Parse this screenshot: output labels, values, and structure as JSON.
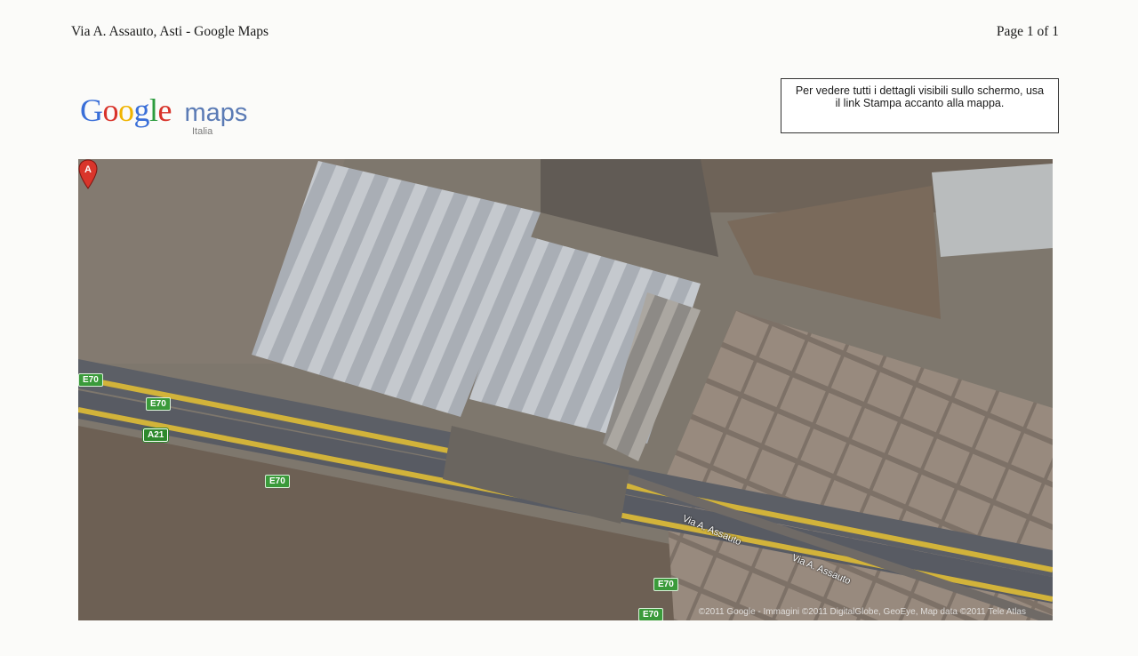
{
  "header": {
    "title": "Via A. Assauto, Asti - Google Maps",
    "page": "Page 1 of 1"
  },
  "logo": {
    "letters": [
      "G",
      "o",
      "o",
      "g",
      "l",
      "e"
    ],
    "letter_colors": [
      "#3a6fd8",
      "#d8332a",
      "#f0b400",
      "#3a6fd8",
      "#2c9c3e",
      "#d8332a"
    ],
    "product": "maps",
    "country": "Italia"
  },
  "notice": {
    "text": "Per vedere tutti i dettagli visibili sullo schermo, usa il link Stampa accanto alla mappa."
  },
  "map": {
    "type": "satellite",
    "marker": {
      "label": "A",
      "color": "#d9352b",
      "icon": "map-pin-icon"
    },
    "road_shields": [
      {
        "text": "E70"
      },
      {
        "text": "E70"
      },
      {
        "text": "A21"
      },
      {
        "text": "E70"
      },
      {
        "text": "E70"
      },
      {
        "text": "E70"
      }
    ],
    "street_labels": [
      {
        "text": "Via A. Assauto"
      },
      {
        "text": "Via A. Assauto"
      }
    ],
    "attribution": "©2011 Google - Immagini ©2011 DigitalGlobe, GeoEye, Map data ©2011 Tele Atlas"
  }
}
